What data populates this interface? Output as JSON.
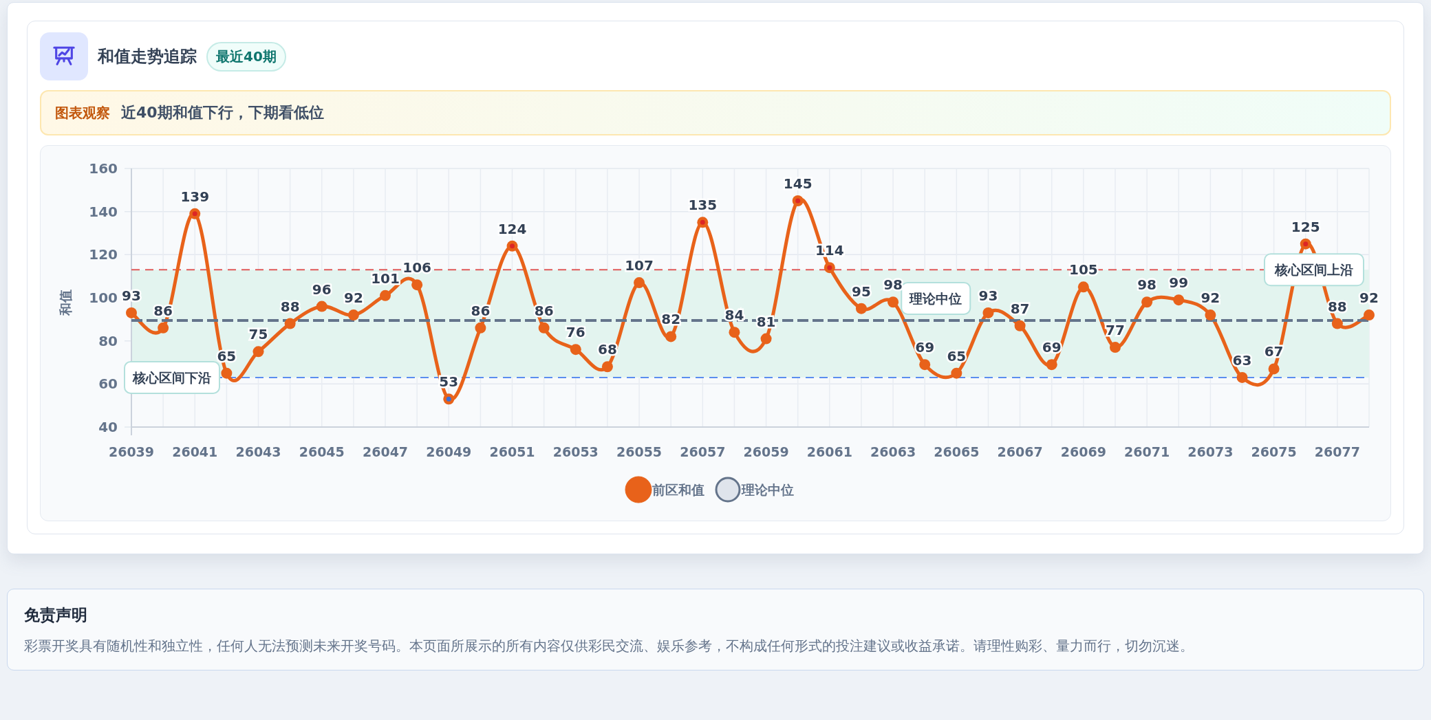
{
  "header": {
    "title": "和值走势追踪",
    "badge": "最近40期"
  },
  "insight": {
    "label": "图表观察",
    "text": "近40期和值下行，下期看低位"
  },
  "chart": {
    "chart_data": {
      "type": "line",
      "ylabel": "和值",
      "ylim": [
        40,
        160
      ],
      "yticks": [
        40,
        60,
        80,
        100,
        120,
        140,
        160
      ],
      "grid": true,
      "legend": true,
      "x": [
        26039,
        26040,
        26041,
        26042,
        26043,
        26044,
        26045,
        26046,
        26047,
        26048,
        26049,
        26050,
        26051,
        26052,
        26053,
        26054,
        26055,
        26056,
        26057,
        26058,
        26059,
        26060,
        26061,
        26062,
        26063,
        26064,
        26065,
        26066,
        26067,
        26068,
        26069,
        26070,
        26071,
        26072,
        26073,
        26074,
        26075,
        26076,
        26077,
        26078
      ],
      "xlim": [
        26039,
        26078
      ],
      "xticks": [
        26039,
        26041,
        26043,
        26045,
        26047,
        26049,
        26051,
        26053,
        26055,
        26057,
        26059,
        26061,
        26063,
        26065,
        26067,
        26069,
        26071,
        26073,
        26075,
        26077
      ],
      "series": [
        {
          "name": "前区和值",
          "color": "#e8621a",
          "marker": "circle",
          "data_labels": true,
          "values": [
            93,
            86,
            139,
            65,
            75,
            88,
            96,
            92,
            101,
            106,
            53,
            86,
            124,
            86,
            76,
            68,
            107,
            82,
            135,
            84,
            81,
            145,
            114,
            95,
            98,
            69,
            65,
            93,
            87,
            69,
            105,
            77,
            98,
            99,
            92,
            63,
            67,
            125,
            88,
            92
          ]
        },
        {
          "name": "理论中位",
          "color": "#64748b",
          "line_style": "dashed",
          "values": [
            89.5,
            89.5,
            89.5,
            89.5,
            89.5,
            89.5,
            89.5,
            89.5,
            89.5,
            89.5,
            89.5,
            89.5,
            89.5,
            89.5,
            89.5,
            89.5,
            89.5,
            89.5,
            89.5,
            89.5,
            89.5,
            89.5,
            89.5,
            89.5,
            89.5,
            89.5,
            89.5,
            89.5,
            89.5,
            89.5,
            89.5,
            89.5,
            89.5,
            89.5,
            89.5,
            89.5,
            89.5,
            89.5,
            89.5,
            89.5
          ]
        }
      ],
      "ref_lines": [
        {
          "axis": "y",
          "value": 113,
          "label": "核心区间上沿",
          "color": "#e05a5a"
        },
        {
          "axis": "y",
          "value": 63,
          "label": "核心区间下沿",
          "color": "#5b8def"
        }
      ],
      "bands": [
        {
          "axis": "y",
          "from": 63,
          "to": 113,
          "color": "#e3f4ef"
        }
      ],
      "annotations": [
        {
          "text": "理论中位",
          "x": 26064.5,
          "y": 89.5
        }
      ]
    }
  },
  "disclaimer": {
    "title": "免责声明",
    "text": "彩票开奖具有随机性和独立性，任何人无法预测未来开奖号码。本页面所展示的所有内容仅供彩民交流、娱乐参考，不构成任何形式的投注建议或收益承诺。请理性购彩、量力而行，切勿沉迷。"
  }
}
